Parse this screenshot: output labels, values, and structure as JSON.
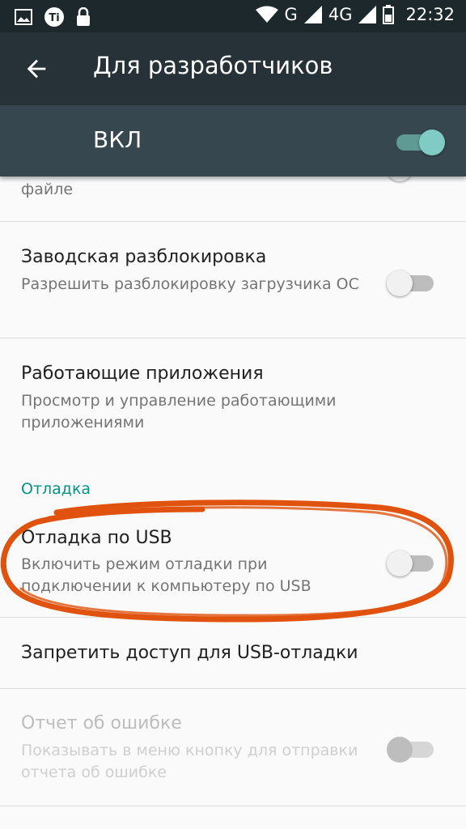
{
  "status_bar": {
    "network_g": "G",
    "network_4g": "4G",
    "time": "22:32",
    "icons": [
      "image-icon",
      "ti-app-icon",
      "lock-icon",
      "wifi-icon",
      "signal-icon",
      "signal-icon",
      "battery-icon"
    ]
  },
  "toolbar": {
    "title": "Для разработчиков",
    "back_icon": "arrow-back-icon"
  },
  "master_switch": {
    "label": "ВКЛ",
    "on": true
  },
  "items": [
    {
      "title": "",
      "summary": "файле",
      "switch": "off"
    },
    {
      "title": "Заводская разблокировка",
      "summary": "Разрешить разблокировку загрузчика ОС",
      "switch": "off"
    },
    {
      "title": "Работающие приложения",
      "summary": "Просмотр и управление работающими приложениями"
    },
    {
      "title": "Отладка по USB",
      "summary": "Включить режим отладки при подключении к компьютеру по USB",
      "switch": "off"
    },
    {
      "title": "Запретить доступ для USB-отладки"
    },
    {
      "title": "Отчет об ошибке",
      "summary": "Показывать в меню кнопку для отправки отчета об ошибке",
      "switch": "disabled"
    }
  ],
  "section": {
    "label": "Отладка"
  },
  "colors": {
    "accent": "#009688",
    "toolbar": "#263238",
    "master_bar": "#37474f",
    "annotation": "#e0530e"
  }
}
